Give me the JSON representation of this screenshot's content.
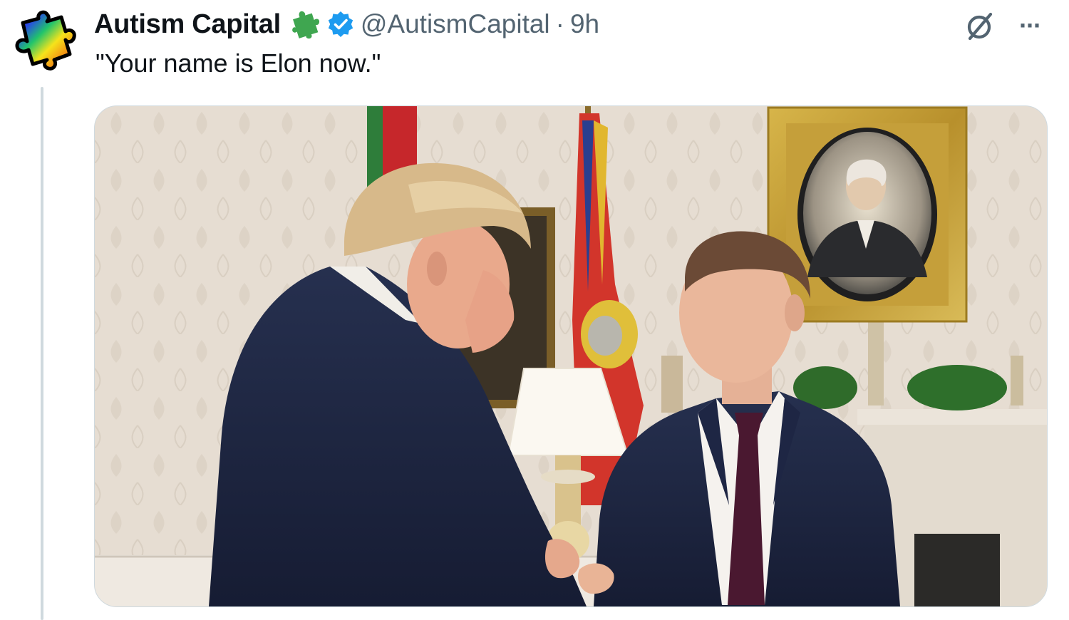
{
  "tweet": {
    "display_name": "Autism Capital",
    "handle": "@AutismCapital",
    "separator": "·",
    "time": "9h",
    "text": "\"Your name is Elon now.\"",
    "more_label": "···"
  },
  "icons": {
    "avatar": "rainbow-puzzle-piece",
    "affiliate_badge": "green-puzzle-piece",
    "verified": "blue-checkmark",
    "grok": "grok-icon",
    "more": "ellipsis-icon"
  },
  "colors": {
    "verified_blue": "#1d9bf0",
    "secondary_text": "#536471",
    "primary_text": "#0f1419",
    "border": "#cfd9de"
  }
}
